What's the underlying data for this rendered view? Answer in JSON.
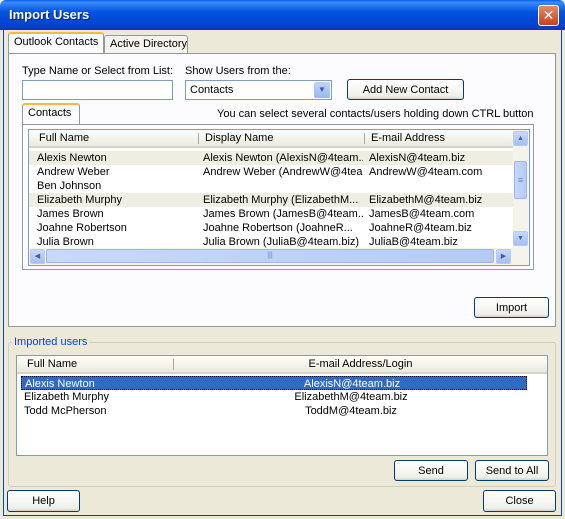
{
  "window": {
    "title": "Import Users",
    "close_glyph": "✕"
  },
  "tabs": [
    {
      "label": "Outlook Contacts",
      "active": true
    },
    {
      "label": "Active Directory",
      "active": false
    }
  ],
  "search": {
    "label": "Type Name or Select from List:",
    "value": ""
  },
  "show_users": {
    "label": "Show Users from the:",
    "selected": "Contacts"
  },
  "add_contact_label": "Add New Contact",
  "inner_tab": {
    "label": "Contacts"
  },
  "hint": "You can select several contacts/users holding down CTRL button",
  "contacts_table": {
    "columns": [
      "Full Name",
      "Display Name",
      "E-mail Address"
    ],
    "rows": [
      {
        "full_name": "Alexis Newton",
        "display_name": "Alexis Newton (AlexisN@4team...",
        "email": "AlexisN@4team.biz",
        "highlight": true
      },
      {
        "full_name": "Andrew Weber",
        "display_name": "Andrew Weber (AndrewW@4tea...",
        "email": "AndrewW@4team.com",
        "highlight": false
      },
      {
        "full_name": "Ben Johnson",
        "display_name": "",
        "email": "",
        "highlight": false
      },
      {
        "full_name": "Elizabeth Murphy",
        "display_name": "Elizabeth Murphy (ElizabethM...",
        "email": "ElizabethM@4team.biz",
        "highlight": true
      },
      {
        "full_name": "James Brown",
        "display_name": "James Brown (JamesB@4team...",
        "email": "JamesB@4team.com",
        "highlight": false
      },
      {
        "full_name": "Joahne Robertson",
        "display_name": "Joahne Robertson (JoahneR...",
        "email": "JoahneR@4team.biz",
        "highlight": false
      },
      {
        "full_name": "Julia Brown",
        "display_name": "Julia Brown (JuliaB@4team.biz)",
        "email": "JuliaB@4team.biz",
        "highlight": false
      }
    ]
  },
  "import_label": "Import",
  "imported_group": {
    "title": "Imported users",
    "columns": [
      "Full Name",
      "E-mail Address/Login"
    ],
    "rows": [
      {
        "full_name": "Alexis Newton",
        "email": "AlexisN@4team.biz",
        "selected": true
      },
      {
        "full_name": "Elizabeth Murphy",
        "email": "ElizabethM@4team.biz",
        "selected": false
      },
      {
        "full_name": "Todd McPherson",
        "email": "ToddM@4team.biz",
        "selected": false
      }
    ]
  },
  "send_label": "Send",
  "send_all_label": "Send to All",
  "help_label": "Help",
  "close_label": "Close",
  "scroll": {
    "up": "▲",
    "down": "▼",
    "left": "◀",
    "right": "▶",
    "grip": "≡",
    "hgrip": "|||"
  },
  "combo_arrow_glyph": "▼"
}
